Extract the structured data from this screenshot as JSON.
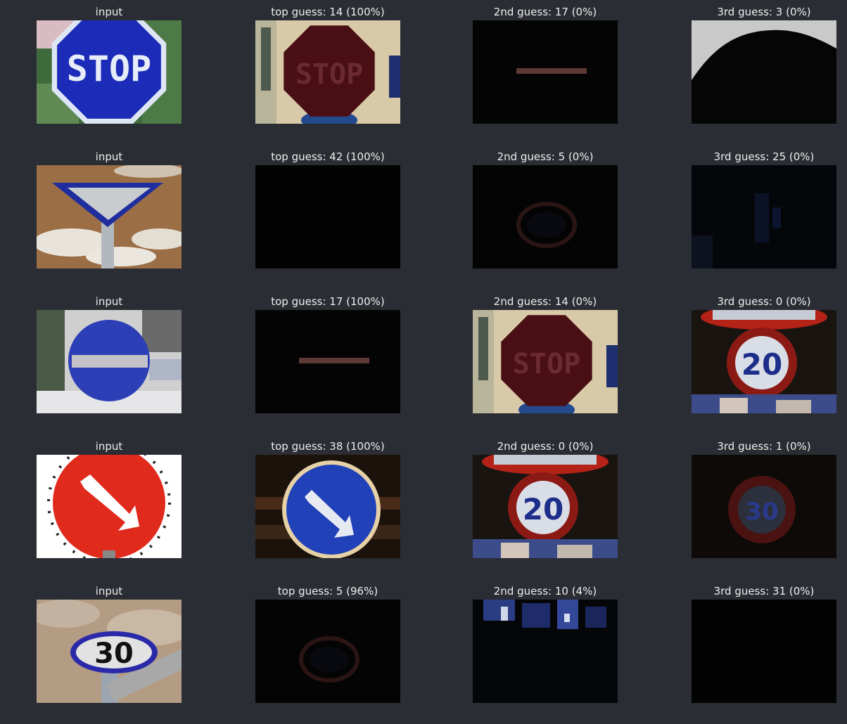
{
  "grid": {
    "rows": [
      {
        "cells": [
          {
            "label": "input",
            "image": "stop-sign-blue"
          },
          {
            "label": "top guess: 14 (100%)",
            "image": "stop-sign-dark-red"
          },
          {
            "label": "2nd guess: 17 (0%)",
            "image": "no-entry-bar-dark"
          },
          {
            "label": "3rd guess: 3 (0%)",
            "image": "dark-silhouette"
          }
        ]
      },
      {
        "cells": [
          {
            "label": "input",
            "image": "yield-sign-brown-sky"
          },
          {
            "label": "top guess: 42 (100%)",
            "image": "black-image"
          },
          {
            "label": "2nd guess: 5 (0%)",
            "image": "faint-speed-limit"
          },
          {
            "label": "3rd guess: 25 (0%)",
            "image": "dark-blue-noise"
          }
        ]
      },
      {
        "cells": [
          {
            "label": "input",
            "image": "no-entry-blue-sign"
          },
          {
            "label": "top guess: 17 (100%)",
            "image": "no-entry-bar-dark"
          },
          {
            "label": "2nd guess: 14 (0%)",
            "image": "stop-sign-dark-red"
          },
          {
            "label": "3rd guess: 0 (0%)",
            "image": "speed-limit-20"
          }
        ]
      },
      {
        "cells": [
          {
            "label": "input",
            "image": "keep-right-red-white"
          },
          {
            "label": "top guess: 38 (100%)",
            "image": "keep-right-blue"
          },
          {
            "label": "2nd guess: 0 (0%)",
            "image": "speed-limit-20"
          },
          {
            "label": "3rd guess: 1 (0%)",
            "image": "dark-speed-limit"
          }
        ]
      },
      {
        "cells": [
          {
            "label": "input",
            "image": "speed-limit-30-input"
          },
          {
            "label": "top guess: 5 (96%)",
            "image": "faint-speed-limit"
          },
          {
            "label": "2nd guess: 10 (4%)",
            "image": "blue-blobs-dark"
          },
          {
            "label": "3rd guess: 31 (0%)",
            "image": "black-image"
          }
        ]
      }
    ]
  }
}
